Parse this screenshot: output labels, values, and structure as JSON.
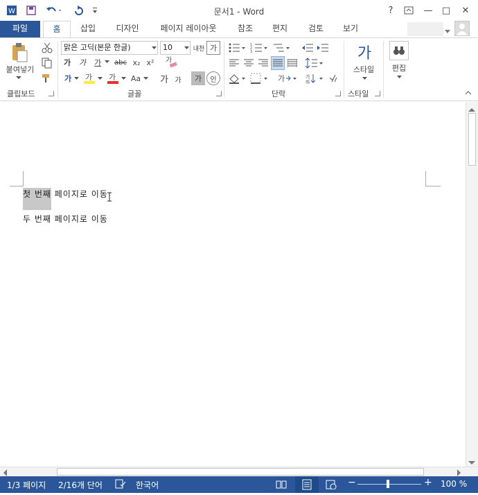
{
  "window": {
    "title": "문서1 - Word",
    "help": "?",
    "minimize": "—",
    "maximize": "□",
    "close": "✕"
  },
  "quick_access": [
    "word-logo-icon",
    "save-icon",
    "undo-icon",
    "redo-icon",
    "customize-icon"
  ],
  "tabs": [
    {
      "label": "파일"
    },
    {
      "label": "홈"
    },
    {
      "label": "삽입"
    },
    {
      "label": "디자인"
    },
    {
      "label": "페이지 레이아웃"
    },
    {
      "label": "참조"
    },
    {
      "label": "편지"
    },
    {
      "label": "검토"
    },
    {
      "label": "보기"
    }
  ],
  "ribbon": {
    "clipboard": {
      "paste_label": "붙여넣기",
      "group_label": "클립보드"
    },
    "font": {
      "font_name": "맑은 고딕(본문 한글)",
      "font_size": "10",
      "group_label": "글꼴",
      "aa_label": "Aa"
    },
    "paragraph": {
      "group_label": "단락"
    },
    "styles": {
      "style_label": "스타일",
      "group_label": "스타일",
      "style_glyph": "가"
    },
    "editing": {
      "edit_label": "편집"
    }
  },
  "document": {
    "line1": "첫 번째 페이지로 이동",
    "line1_selected": "첫 번째",
    "line1_rest": " 페이지로 이동",
    "line2": "두 번째 페이지로 이동"
  },
  "status": {
    "page": "1/3 페이지",
    "words": "2/16개 단어",
    "language": "한국어",
    "zoom": "100 %"
  },
  "colors": {
    "accent": "#2b579a",
    "highlight": "#ffeb3b",
    "font_color": "#e03030"
  }
}
